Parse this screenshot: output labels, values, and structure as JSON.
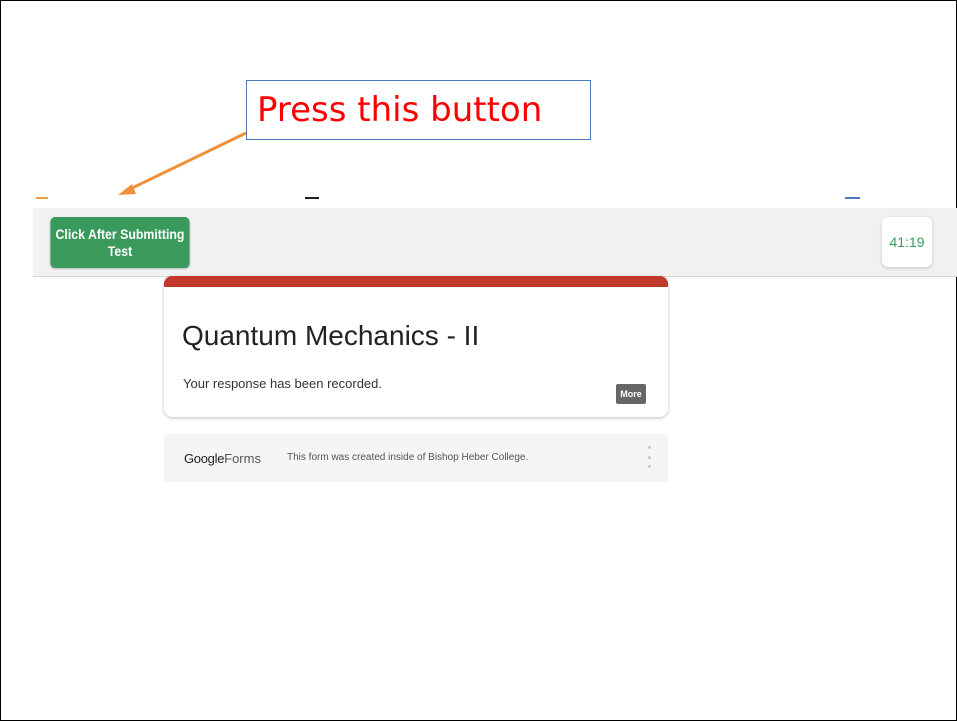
{
  "annotation": {
    "callout_text": "Press this button",
    "arrow_color": "#f0913a",
    "text_color": "#ff0000"
  },
  "toolbar": {
    "submit_button_label_line1": "Click After Submitting",
    "submit_button_label_line2": "Test",
    "timer": "41:19",
    "accent_color": "#3a9a5b"
  },
  "form": {
    "title": "Quantum Mechanics - II",
    "message": "Your response has been recorded.",
    "more_button": "More",
    "header_color": "#c0392b"
  },
  "footer": {
    "logo_google": "Google",
    "logo_forms": "Forms",
    "note": "This form was created inside of Bishop Heber College.",
    "menu_icon": "kebab-menu-icon"
  }
}
